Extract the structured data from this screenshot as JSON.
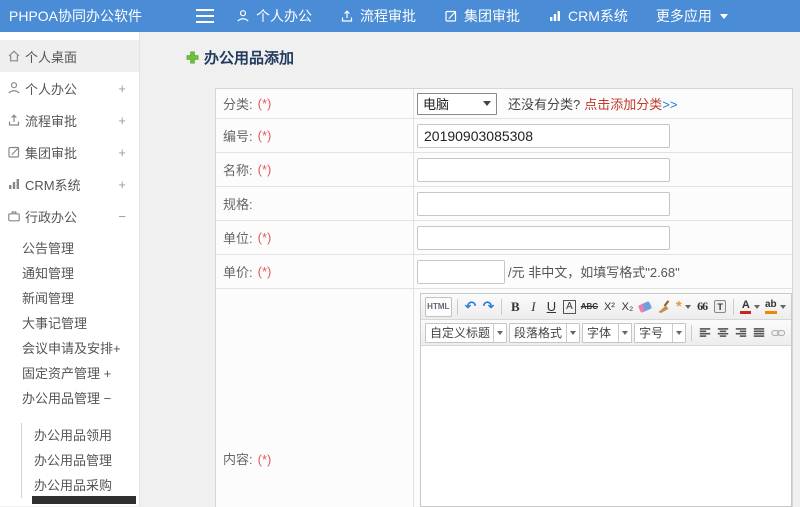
{
  "topbar": {
    "brand": "PHPOA协同办公软件",
    "nav": [
      "个人办公",
      "流程审批",
      "集团审批",
      "CRM系统",
      "更多应用"
    ]
  },
  "sidebar": {
    "top": [
      "个人桌面",
      "个人办公",
      "流程审批",
      "集团审批",
      "CRM系统",
      "行政办公"
    ],
    "toggle_plus": "+",
    "toggle_minus": "−",
    "admin_children": [
      "公告管理",
      "通知管理",
      "新闻管理",
      "大事记管理",
      "会议申请及安排+",
      "固定资产管理  +",
      "办公用品管理  −"
    ],
    "supplies_children": [
      "办公用品领用",
      "办公用品管理",
      "办公用品采购"
    ]
  },
  "page": {
    "title": "办公用品添加"
  },
  "form": {
    "required_mark": "(*)",
    "category": {
      "label": "分类:",
      "select_value": "电脑",
      "hint": "还没有分类?",
      "link": "点击添加分类",
      "arrows": ">>"
    },
    "code": {
      "label": "编号:",
      "value": "20190903085308"
    },
    "name": {
      "label": "名称:"
    },
    "spec": {
      "label": "规格:"
    },
    "unit": {
      "label": "单位:"
    },
    "price": {
      "label": "单价:",
      "suffix": "/元 非中文，如填写格式\"2.68\""
    },
    "content": {
      "label": "内容:"
    }
  },
  "editor": {
    "source": "HTML",
    "undo": "↶",
    "redo": "↷",
    "bold": "B",
    "italic": "I",
    "underline": "U",
    "char_border": "A",
    "strike": "ABC",
    "superscript": "X²",
    "subscript": "X₂",
    "autotypeset": "*",
    "blockquote": "66",
    "paste_text": "T",
    "font_color": "A",
    "highlight": "ab",
    "selects": [
      "自定义标题",
      "段落格式",
      "字体",
      "字号"
    ]
  },
  "colors": {
    "topbar_blue": "#4a8cd6",
    "title_navy": "#223a5e",
    "accent_green": "#6fbf3f",
    "required_red": "#e25b5b",
    "link_red": "#c0392b",
    "link_blue": "#1a7ad9"
  }
}
